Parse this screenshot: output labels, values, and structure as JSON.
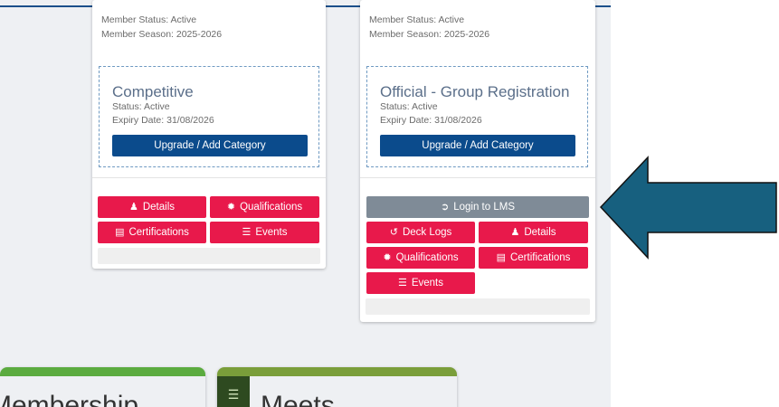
{
  "cards": [
    {
      "meta": [
        "Member Status: Active",
        "Member Season: 2025-2026"
      ],
      "category": {
        "title": "Competitive",
        "status": "Status: Active",
        "expiry": "Expiry Date: 31/08/2026",
        "upgrade": "Upgrade / Add Category"
      },
      "buttons": {
        "details": "Details",
        "qualifications": "Qualifications",
        "certifications": "Certifications",
        "events": "Events"
      }
    },
    {
      "meta": [
        "Member Status: Active",
        "Member Season: 2025-2026"
      ],
      "category": {
        "title": "Official - Group Registration",
        "status": "Status: Active",
        "expiry": "Expiry Date: 31/08/2026",
        "upgrade": "Upgrade / Add Category"
      },
      "buttons": {
        "lms": "Login to LMS",
        "deck_logs": "Deck Logs",
        "details": "Details",
        "qualifications": "Qualifications",
        "certifications": "Certifications",
        "events": "Events"
      }
    }
  ],
  "tiles": [
    {
      "title": "Membership"
    },
    {
      "title": "Meets"
    }
  ],
  "colors": {
    "primary_button": "#0b4b8c",
    "action_button": "#e8194b",
    "lms_button": "#7f8b97",
    "arrow_fill": "#17607f",
    "tile_green": "#7a9e3a"
  }
}
